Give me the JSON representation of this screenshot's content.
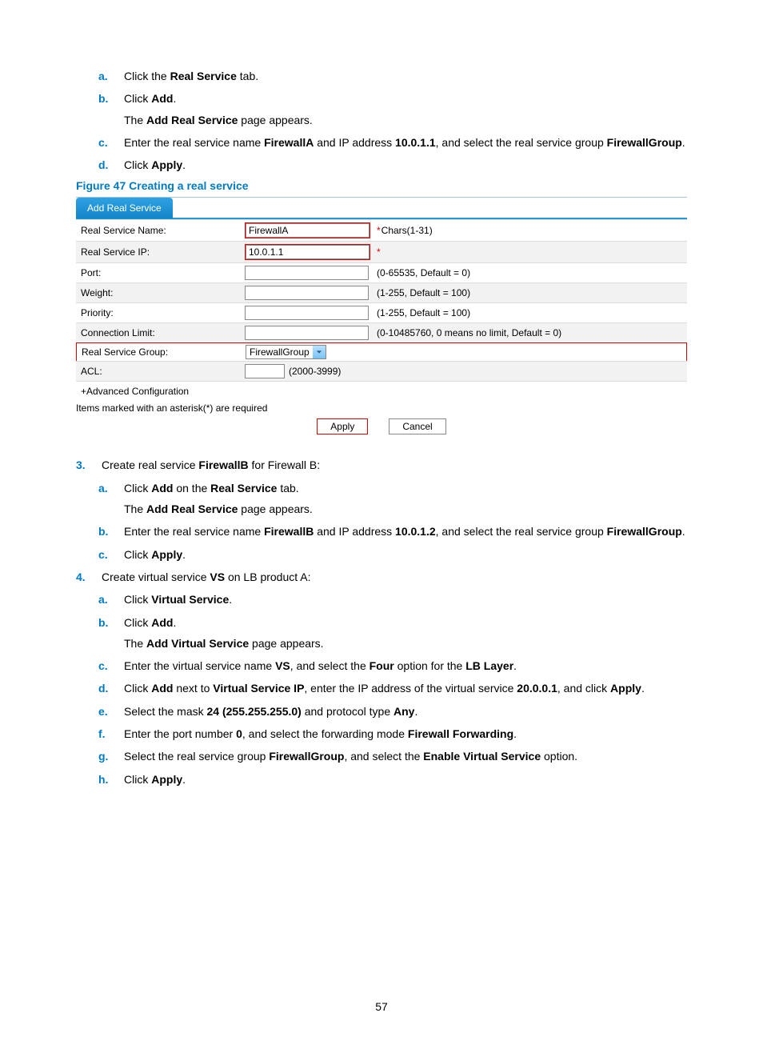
{
  "steps_a": {
    "a": {
      "pre": "Click the ",
      "bold": "Real Service",
      "post": " tab."
    },
    "b": {
      "pre": "Click ",
      "bold": "Add",
      "post": "."
    },
    "b_sub": {
      "pre": "The ",
      "bold": "Add Real Service",
      "post": " page appears."
    },
    "c": {
      "pre": "Enter the real service name ",
      "bold1": "FirewallA",
      "mid": " and IP address ",
      "bold2": "10.0.1.1",
      "mid2": ", and select the real service group ",
      "bold3": "FirewallGroup",
      "post": "."
    },
    "d": {
      "pre": "Click ",
      "bold": "Apply",
      "post": "."
    }
  },
  "figure_caption": "Figure 47 Creating a real service",
  "tab_label": "Add Real Service",
  "form": {
    "rows": {
      "name": {
        "label": "Real Service Name:",
        "value": "FirewallA",
        "hint": "Chars(1-31)",
        "required": true
      },
      "ip": {
        "label": "Real Service IP:",
        "value": "10.0.1.1",
        "hint": "",
        "required": true
      },
      "port": {
        "label": "Port:",
        "value": "",
        "hint": "(0-65535, Default = 0)",
        "required": false
      },
      "weight": {
        "label": "Weight:",
        "value": "",
        "hint": "(1-255, Default = 100)",
        "required": false
      },
      "priority": {
        "label": "Priority:",
        "value": "",
        "hint": "(1-255, Default = 100)",
        "required": false
      },
      "conn": {
        "label": "Connection Limit:",
        "value": "",
        "hint": "(0-10485760, 0 means no limit, Default = 0)",
        "required": false
      },
      "group": {
        "label": "Real Service Group:",
        "value": "FirewallGroup"
      },
      "acl": {
        "label": "ACL:",
        "value": "",
        "hint": "(2000-3999)",
        "required": false
      }
    },
    "advanced": "+Advanced Configuration",
    "note": "Items marked with an asterisk(*) are required",
    "apply": "Apply",
    "cancel": "Cancel"
  },
  "step3_intro": {
    "pre": "Create real service ",
    "bold": "FirewallB",
    "post": " for Firewall B:"
  },
  "steps_b": {
    "a": {
      "pre": "Click ",
      "bold": "Add",
      "mid": " on the ",
      "bold2": "Real Service",
      "post": " tab."
    },
    "a_sub": {
      "pre": "The ",
      "bold": "Add Real Service",
      "post": " page appears."
    },
    "b": {
      "pre": "Enter the real service name ",
      "bold1": "FirewallB",
      "mid": " and IP address ",
      "bold2": "10.0.1.2",
      "mid2": ", and select the real service group ",
      "bold3": "FirewallGroup",
      "post": "."
    },
    "c": {
      "pre": "Click ",
      "bold": "Apply",
      "post": "."
    }
  },
  "step4_intro": {
    "pre": "Create virtual service ",
    "bold": "VS",
    "post": " on LB product A:"
  },
  "steps_c": {
    "a": {
      "pre": "Click ",
      "bold": "Virtual Service",
      "post": "."
    },
    "b": {
      "pre": "Click ",
      "bold": "Add",
      "post": "."
    },
    "b_sub": {
      "pre": "The ",
      "bold": "Add Virtual Service",
      "post": " page appears."
    },
    "c": {
      "pre": "Enter the virtual service name ",
      "b1": "VS",
      "mid1": ", and select the ",
      "b2": "Four",
      "mid2": " option for the ",
      "b3": "LB Layer",
      "post": "."
    },
    "d": {
      "pre": "Click ",
      "b1": "Add",
      "mid1": " next to ",
      "b2": "Virtual Service IP",
      "mid2": ", enter the IP address of the virtual service ",
      "b3": "20.0.0.1",
      "mid3": ", and click ",
      "b4": "Apply",
      "post": "."
    },
    "e": {
      "pre": "Select the mask ",
      "b1": "24 (255.255.255.0)",
      "mid": " and protocol type ",
      "b2": "Any",
      "post": "."
    },
    "f": {
      "pre": "Enter the port number ",
      "b1": "0",
      "mid": ", and select the forwarding mode ",
      "b2": "Firewall Forwarding",
      "post": "."
    },
    "g": {
      "pre": "Select the real service group ",
      "b1": "FirewallGroup",
      "mid": ", and select the ",
      "b2": "Enable Virtual Service",
      "post": " option."
    },
    "h": {
      "pre": "Click ",
      "bold": "Apply",
      "post": "."
    }
  },
  "page_number": "57"
}
